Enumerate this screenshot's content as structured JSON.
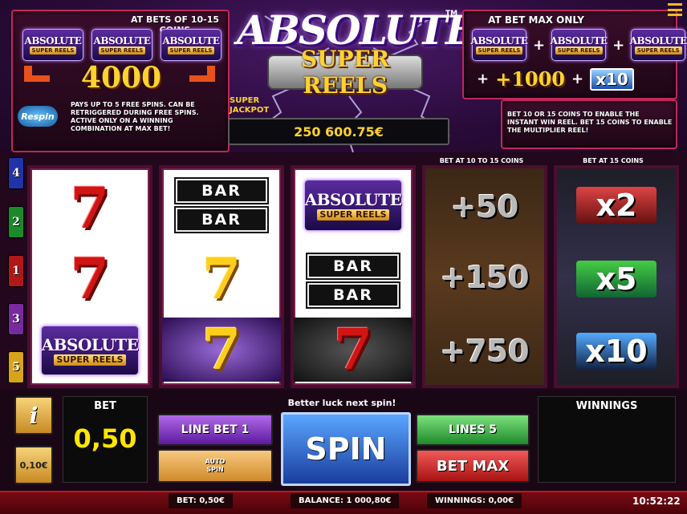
{
  "top_left": {
    "heading": "AT BETS OF 10-15 COINS",
    "logos": [
      "ABSOLUTE",
      "ABSOLUTE",
      "ABSOLUTE"
    ],
    "logo_sub": "SUPER REELS",
    "prize": "4000",
    "respin_label": "Respin",
    "description": "PAYS UP TO 5 FREE SPINS. CAN BE RETRIGGERED DURING FREE SPINS. ACTIVE ONLY ON A WINNING COMBINATION AT MAX BET!"
  },
  "center": {
    "title_line1": "ABSOLUTE",
    "title_line2": "SUPER REELS",
    "trademark": "TM",
    "jackpot_label": "SUPER JACKPOT",
    "jackpot_value": "250 600.75€"
  },
  "top_right": {
    "heading": "AT BET MAX ONLY",
    "prize_plus": "+1000",
    "multiplier": "x10",
    "description": "BET 10 OR 15 COINS TO ENABLE THE INSTANT WIN REEL. BET 15 COINS TO ENABLE THE MULTIPLIER REEL!"
  },
  "menu_icon": "hamburger-icon",
  "line_buttons": [
    "4",
    "2",
    "1",
    "3",
    "5"
  ],
  "line_colors": [
    "#2233aa",
    "#1d8a2a",
    "#b01818",
    "#7a2aa0",
    "#d9a31a"
  ],
  "reels": {
    "reel1": [
      "7",
      "7",
      "ABSOLUTE"
    ],
    "reel2": [
      "BAR",
      "BAR",
      "7",
      "7"
    ],
    "reel3": [
      "ABSOLUTE",
      "BAR",
      "BAR",
      "7"
    ],
    "instant_heading": "BET AT 10 TO 15 COINS",
    "instant_values": [
      "+50",
      "+150",
      "+750"
    ],
    "multiplier_heading": "BET AT 15 COINS",
    "multiplier_values": [
      "x2",
      "x5",
      "x10"
    ]
  },
  "controls": {
    "info": "i",
    "coin_value": "0,10€",
    "bet_label": "BET",
    "bet_value": "0,50",
    "message": "Better luck next spin!",
    "line_bet": "LINE BET 1",
    "auto_spin_line1": "AUTO",
    "auto_spin_line2": "SPIN",
    "spin": "SPIN",
    "lines": "LINES 5",
    "bet_max": "BET MAX",
    "winnings_label": "WINNINGS"
  },
  "bottom_bar": {
    "bet": "BET: 0,50€",
    "balance": "BALANCE: 1 000,80€",
    "winnings": "WINNINGS: 0,00€",
    "clock": "10:52:22"
  }
}
